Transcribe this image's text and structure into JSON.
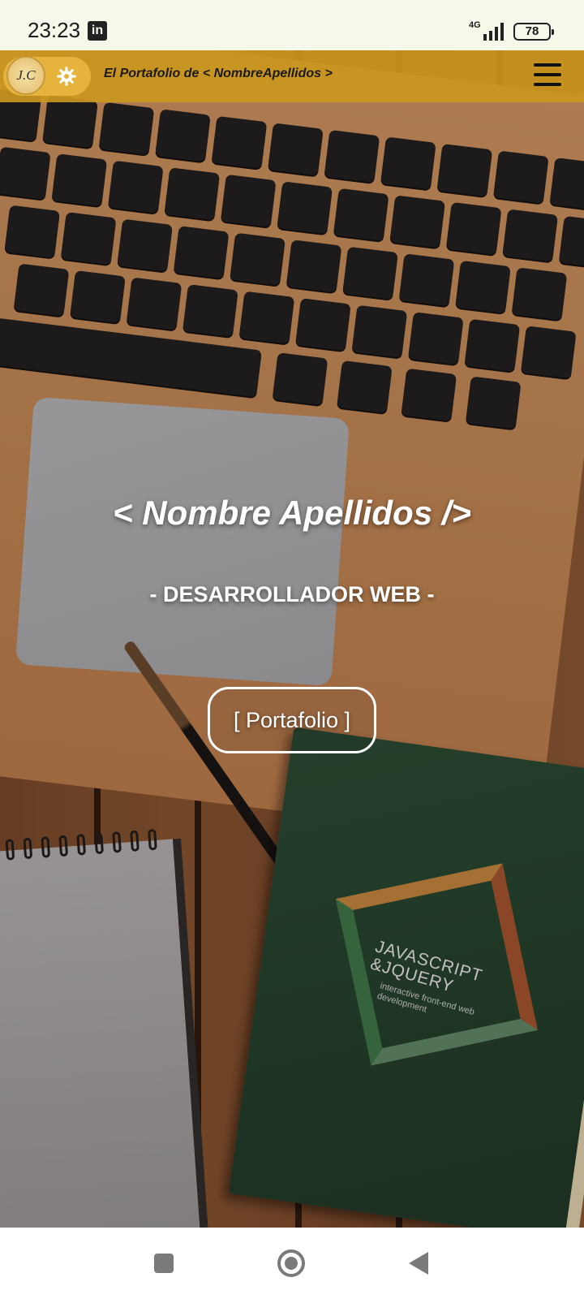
{
  "status_bar": {
    "time": "23:23",
    "app_icon": "in",
    "network": "4G",
    "battery": "78"
  },
  "header": {
    "logo_text": "J.C",
    "site_title": "El Portafolio de < NombreApellidos >"
  },
  "hero": {
    "name": "< Nombre Apellidos />",
    "role": "- DESARROLLADOR WEB -",
    "portfolio_button": "[ Portafolio ]",
    "book_title_line1": "JAVASCRIPT",
    "book_title_line2": "&JQUERY",
    "book_subtitle": "interactive front-end web development"
  },
  "icons": {
    "status_app": "linkedin-icon",
    "settings": "gear-icon",
    "menu": "hamburger-menu-icon",
    "nav_recents": "square-icon",
    "nav_home": "circle-icon",
    "nav_back": "triangle-back-icon"
  },
  "colors": {
    "navbar_bg": "#ca961e",
    "hero_text": "#ffffff",
    "status_bg": "#f7f7ea"
  }
}
